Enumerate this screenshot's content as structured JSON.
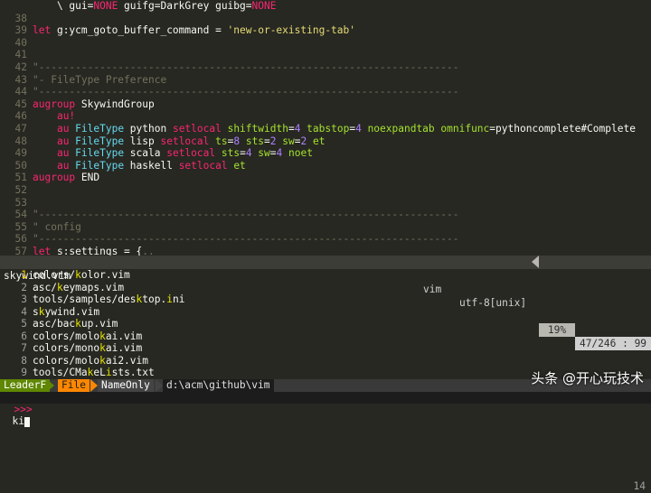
{
  "editor": {
    "lines": [
      {
        "n": "",
        "segs": [
          {
            "t": "    \\ gui=",
            "c": "plain"
          },
          {
            "t": "NONE",
            "c": "kw"
          },
          {
            "t": " guifg=DarkGrey guibg=",
            "c": "plain"
          },
          {
            "t": "NONE",
            "c": "kw"
          }
        ]
      },
      {
        "n": "38",
        "segs": []
      },
      {
        "n": "39",
        "segs": [
          {
            "t": "let ",
            "c": "kw"
          },
          {
            "t": "g:ycm_goto_buffer_command = ",
            "c": "plain"
          },
          {
            "t": "'new-or-existing-tab'",
            "c": "str"
          }
        ]
      },
      {
        "n": "40",
        "segs": []
      },
      {
        "n": "41",
        "segs": []
      },
      {
        "n": "42",
        "segs": [
          {
            "t": "\"---------------------------------------------------------------------",
            "c": "cmt"
          }
        ]
      },
      {
        "n": "43",
        "segs": [
          {
            "t": "\"- FileType Preference",
            "c": "cmt"
          }
        ]
      },
      {
        "n": "44",
        "segs": [
          {
            "t": "\"---------------------------------------------------------------------",
            "c": "cmt"
          }
        ]
      },
      {
        "n": "45",
        "segs": [
          {
            "t": "augroup ",
            "c": "kw"
          },
          {
            "t": "SkywindGroup",
            "c": "plain"
          }
        ]
      },
      {
        "n": "46",
        "segs": [
          {
            "t": "  ",
            "c": "guide"
          },
          {
            "t": "  au!",
            "c": "kw"
          }
        ]
      },
      {
        "n": "47",
        "segs": [
          {
            "t": "  ",
            "c": "guide"
          },
          {
            "t": "  au ",
            "c": "kw"
          },
          {
            "t": "FileType",
            "c": "fn"
          },
          {
            "t": " python ",
            "c": "plain"
          },
          {
            "t": "setlocal ",
            "c": "kw"
          },
          {
            "t": "shiftwidth",
            "c": "opt"
          },
          {
            "t": "=",
            "c": "plain"
          },
          {
            "t": "4",
            "c": "num"
          },
          {
            "t": " tabstop",
            "c": "opt"
          },
          {
            "t": "=",
            "c": "plain"
          },
          {
            "t": "4",
            "c": "num"
          },
          {
            "t": " noexpandtab",
            "c": "opt"
          },
          {
            "t": " omnifunc",
            "c": "opt"
          },
          {
            "t": "=pythoncomplete#Complete",
            "c": "plain"
          }
        ]
      },
      {
        "n": "48",
        "segs": [
          {
            "t": "  ",
            "c": "guide"
          },
          {
            "t": "  au ",
            "c": "kw"
          },
          {
            "t": "FileType",
            "c": "fn"
          },
          {
            "t": " lisp ",
            "c": "plain"
          },
          {
            "t": "setlocal ",
            "c": "kw"
          },
          {
            "t": "ts",
            "c": "opt"
          },
          {
            "t": "=",
            "c": "plain"
          },
          {
            "t": "8",
            "c": "num"
          },
          {
            "t": " sts",
            "c": "opt"
          },
          {
            "t": "=",
            "c": "plain"
          },
          {
            "t": "2",
            "c": "num"
          },
          {
            "t": " sw",
            "c": "opt"
          },
          {
            "t": "=",
            "c": "plain"
          },
          {
            "t": "2",
            "c": "num"
          },
          {
            "t": " et",
            "c": "opt"
          }
        ]
      },
      {
        "n": "49",
        "segs": [
          {
            "t": "  ",
            "c": "guide"
          },
          {
            "t": "  au ",
            "c": "kw"
          },
          {
            "t": "FileType",
            "c": "fn"
          },
          {
            "t": " scala ",
            "c": "plain"
          },
          {
            "t": "setlocal ",
            "c": "kw"
          },
          {
            "t": "sts",
            "c": "opt"
          },
          {
            "t": "=",
            "c": "plain"
          },
          {
            "t": "4",
            "c": "num"
          },
          {
            "t": " sw",
            "c": "opt"
          },
          {
            "t": "=",
            "c": "plain"
          },
          {
            "t": "4",
            "c": "num"
          },
          {
            "t": " noet",
            "c": "opt"
          }
        ]
      },
      {
        "n": "50",
        "segs": [
          {
            "t": "  ",
            "c": "guide"
          },
          {
            "t": "  au ",
            "c": "kw"
          },
          {
            "t": "FileType",
            "c": "fn"
          },
          {
            "t": " haskell ",
            "c": "plain"
          },
          {
            "t": "setlocal ",
            "c": "kw"
          },
          {
            "t": "et",
            "c": "opt"
          }
        ]
      },
      {
        "n": "51",
        "segs": [
          {
            "t": "augroup ",
            "c": "kw"
          },
          {
            "t": "END",
            "c": "plain"
          }
        ]
      },
      {
        "n": "52",
        "segs": []
      },
      {
        "n": "53",
        "segs": []
      },
      {
        "n": "54",
        "segs": [
          {
            "t": "\"---------------------------------------------------------------------",
            "c": "cmt"
          }
        ]
      },
      {
        "n": "55",
        "segs": [
          {
            "t": "\" config",
            "c": "cmt"
          }
        ]
      },
      {
        "n": "56",
        "segs": [
          {
            "t": "\"---------------------------------------------------------------------",
            "c": "cmt"
          }
        ]
      },
      {
        "n": "57",
        "segs": [
          {
            "t": "let ",
            "c": "kw"
          },
          {
            "t": "s:settings = {",
            "c": "plain"
          },
          {
            "t": "..",
            "c": "cmt"
          }
        ]
      }
    ]
  },
  "status": {
    "filename": "skywind.vim",
    "filetype": "vim",
    "encoding": "utf-8[unix]",
    "percent": "19%",
    "position": "47/246 : 99"
  },
  "results": [
    {
      "idx": "1",
      "selected": true,
      "segs": [
        {
          "t": "colors/",
          "m": false
        },
        {
          "t": "k",
          "m": true
        },
        {
          "t": "olor.vim",
          "m": false
        }
      ]
    },
    {
      "idx": "2",
      "selected": false,
      "segs": [
        {
          "t": "asc/",
          "m": false
        },
        {
          "t": "k",
          "m": true
        },
        {
          "t": "eymaps.vim",
          "m": false
        }
      ]
    },
    {
      "idx": "3",
      "selected": false,
      "segs": [
        {
          "t": "tools/samples/des",
          "m": false
        },
        {
          "t": "k",
          "m": true
        },
        {
          "t": "top.",
          "m": false
        },
        {
          "t": "i",
          "m": true
        },
        {
          "t": "ni",
          "m": false
        }
      ]
    },
    {
      "idx": "4",
      "selected": false,
      "segs": [
        {
          "t": "s",
          "m": false
        },
        {
          "t": "k",
          "m": true
        },
        {
          "t": "ywind.vim",
          "m": false
        }
      ]
    },
    {
      "idx": "5",
      "selected": false,
      "segs": [
        {
          "t": "asc/bac",
          "m": false
        },
        {
          "t": "k",
          "m": true
        },
        {
          "t": "up.vim",
          "m": false
        }
      ]
    },
    {
      "idx": "6",
      "selected": false,
      "segs": [
        {
          "t": "colors/molo",
          "m": false
        },
        {
          "t": "k",
          "m": true
        },
        {
          "t": "ai.vim",
          "m": false
        }
      ]
    },
    {
      "idx": "7",
      "selected": false,
      "segs": [
        {
          "t": "colors/mono",
          "m": false
        },
        {
          "t": "k",
          "m": true
        },
        {
          "t": "ai.vim",
          "m": false
        }
      ]
    },
    {
      "idx": "8",
      "selected": false,
      "segs": [
        {
          "t": "colors/molo",
          "m": false
        },
        {
          "t": "k",
          "m": true
        },
        {
          "t": "ai2.vim",
          "m": false
        }
      ]
    },
    {
      "idx": "9",
      "selected": false,
      "segs": [
        {
          "t": "tools/CMa",
          "m": false
        },
        {
          "t": "k",
          "m": true
        },
        {
          "t": "eL",
          "m": false
        },
        {
          "t": "i",
          "m": true
        },
        {
          "t": "sts.txt",
          "m": false
        }
      ]
    }
  ],
  "leaderf": {
    "name": "LeaderF",
    "mode": "File",
    "match": "NameOnly",
    "cwd": "d:\\acm\\github\\vim",
    "count": "14"
  },
  "prompt": {
    "symbol": ">>>",
    "value": "ki"
  },
  "watermark": "头条 @开心玩技术",
  "colors": {
    "background": "#272822",
    "keyword": "#f92672",
    "function": "#66d9ef",
    "string": "#e6db74",
    "number": "#ae81ff",
    "comment": "#75715e",
    "option": "#a6e22e",
    "match": "#e6e600"
  }
}
